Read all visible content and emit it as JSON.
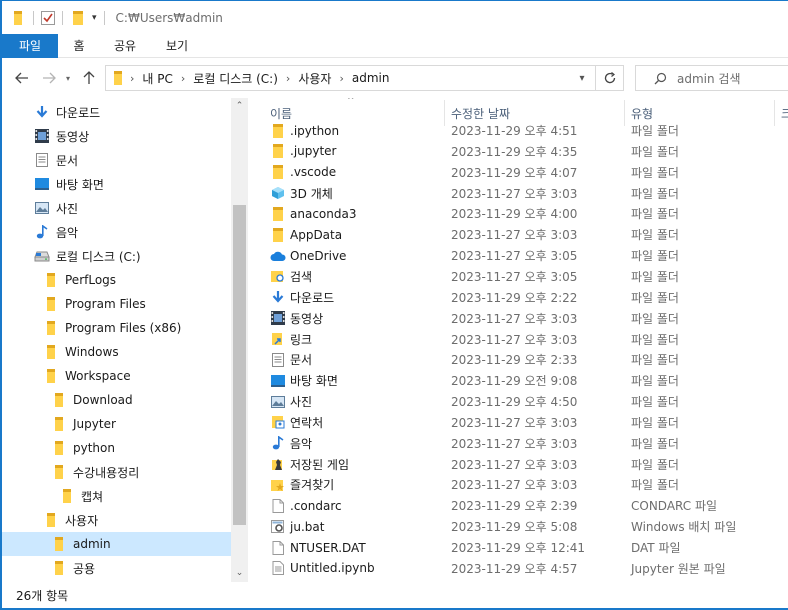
{
  "titlebar": {
    "path": "C:₩Users₩admin"
  },
  "ribbon": {
    "tabs": [
      {
        "label": "파일"
      },
      {
        "label": "홈"
      },
      {
        "label": "공유"
      },
      {
        "label": "보기"
      }
    ]
  },
  "address": {
    "crumbs": [
      "내 PC",
      "로컬 디스크 (C:)",
      "사용자",
      "admin"
    ]
  },
  "search": {
    "placeholder": "admin 검색"
  },
  "navpane": {
    "items": [
      {
        "label": "다운로드",
        "icon": "download-arrow-icon"
      },
      {
        "label": "동영상",
        "icon": "film-icon"
      },
      {
        "label": "문서",
        "icon": "document-icon"
      },
      {
        "label": "바탕 화면",
        "icon": "desktop-icon"
      },
      {
        "label": "사진",
        "icon": "picture-icon"
      },
      {
        "label": "음악",
        "icon": "music-note-icon"
      },
      {
        "label": "로컬 디스크 (C:)",
        "icon": "drive-icon"
      },
      {
        "label": "PerfLogs",
        "icon": "folder-icon"
      },
      {
        "label": "Program Files",
        "icon": "folder-icon"
      },
      {
        "label": "Program Files (x86)",
        "icon": "folder-icon"
      },
      {
        "label": "Windows",
        "icon": "folder-icon"
      },
      {
        "label": "Workspace",
        "icon": "folder-icon"
      },
      {
        "label": "Download",
        "icon": "folder-icon"
      },
      {
        "label": "Jupyter",
        "icon": "folder-icon"
      },
      {
        "label": "python",
        "icon": "folder-icon"
      },
      {
        "label": "수강내용정리",
        "icon": "folder-icon"
      },
      {
        "label": "캡쳐",
        "icon": "folder-icon"
      },
      {
        "label": "사용자",
        "icon": "folder-icon"
      },
      {
        "label": "admin",
        "icon": "folder-icon",
        "selected": true
      },
      {
        "label": "공용",
        "icon": "folder-icon"
      }
    ]
  },
  "list": {
    "columns": {
      "name": "이름",
      "date": "수정한 날짜",
      "type": "유형",
      "size": "크"
    },
    "rows": [
      {
        "name": ".ipython",
        "date": "2023-11-29 오후 4:51",
        "type": "파일 폴더",
        "icon": "folder-icon"
      },
      {
        "name": ".jupyter",
        "date": "2023-11-29 오후 4:35",
        "type": "파일 폴더",
        "icon": "folder-icon"
      },
      {
        "name": ".vscode",
        "date": "2023-11-29 오후 4:07",
        "type": "파일 폴더",
        "icon": "folder-icon"
      },
      {
        "name": "3D 개체",
        "date": "2023-11-27 오후 3:03",
        "type": "파일 폴더",
        "icon": "cube-3d-icon"
      },
      {
        "name": "anaconda3",
        "date": "2023-11-29 오후 4:00",
        "type": "파일 폴더",
        "icon": "folder-icon"
      },
      {
        "name": "AppData",
        "date": "2023-11-27 오후 3:03",
        "type": "파일 폴더",
        "icon": "folder-icon"
      },
      {
        "name": "OneDrive",
        "date": "2023-11-27 오후 3:05",
        "type": "파일 폴더",
        "icon": "cloud-icon"
      },
      {
        "name": "검색",
        "date": "2023-11-27 오후 3:05",
        "type": "파일 폴더",
        "icon": "search-folder-icon"
      },
      {
        "name": "다운로드",
        "date": "2023-11-29 오후 2:22",
        "type": "파일 폴더",
        "icon": "download-arrow-icon"
      },
      {
        "name": "동영상",
        "date": "2023-11-27 오후 3:03",
        "type": "파일 폴더",
        "icon": "film-icon"
      },
      {
        "name": "링크",
        "date": "2023-11-27 오후 3:03",
        "type": "파일 폴더",
        "icon": "link-folder-icon"
      },
      {
        "name": "문서",
        "date": "2023-11-29 오후 2:33",
        "type": "파일 폴더",
        "icon": "document-icon"
      },
      {
        "name": "바탕 화면",
        "date": "2023-11-29 오전 9:08",
        "type": "파일 폴더",
        "icon": "desktop-icon"
      },
      {
        "name": "사진",
        "date": "2023-11-29 오후 4:50",
        "type": "파일 폴더",
        "icon": "picture-icon"
      },
      {
        "name": "연락처",
        "date": "2023-11-27 오후 3:03",
        "type": "파일 폴더",
        "icon": "contacts-icon"
      },
      {
        "name": "음악",
        "date": "2023-11-27 오후 3:03",
        "type": "파일 폴더",
        "icon": "music-note-icon"
      },
      {
        "name": "저장된 게임",
        "date": "2023-11-27 오후 3:03",
        "type": "파일 폴더",
        "icon": "chess-piece-icon"
      },
      {
        "name": "즐겨찾기",
        "date": "2023-11-27 오후 3:03",
        "type": "파일 폴더",
        "icon": "star-folder-icon"
      },
      {
        "name": ".condarc",
        "date": "2023-11-29 오후 2:39",
        "type": "CONDARC 파일",
        "icon": "blank-file-icon"
      },
      {
        "name": "ju.bat",
        "date": "2023-11-29 오후 5:08",
        "type": "Windows 배치 파일",
        "icon": "gear-file-icon"
      },
      {
        "name": "NTUSER.DAT",
        "date": "2023-11-29 오후 12:41",
        "type": "DAT 파일",
        "icon": "blank-file-icon"
      },
      {
        "name": "Untitled.ipynb",
        "date": "2023-11-29 오후 4:57",
        "type": "Jupyter 원본 파일",
        "icon": "text-file-icon"
      }
    ]
  },
  "status": {
    "count": "26개 항목"
  }
}
